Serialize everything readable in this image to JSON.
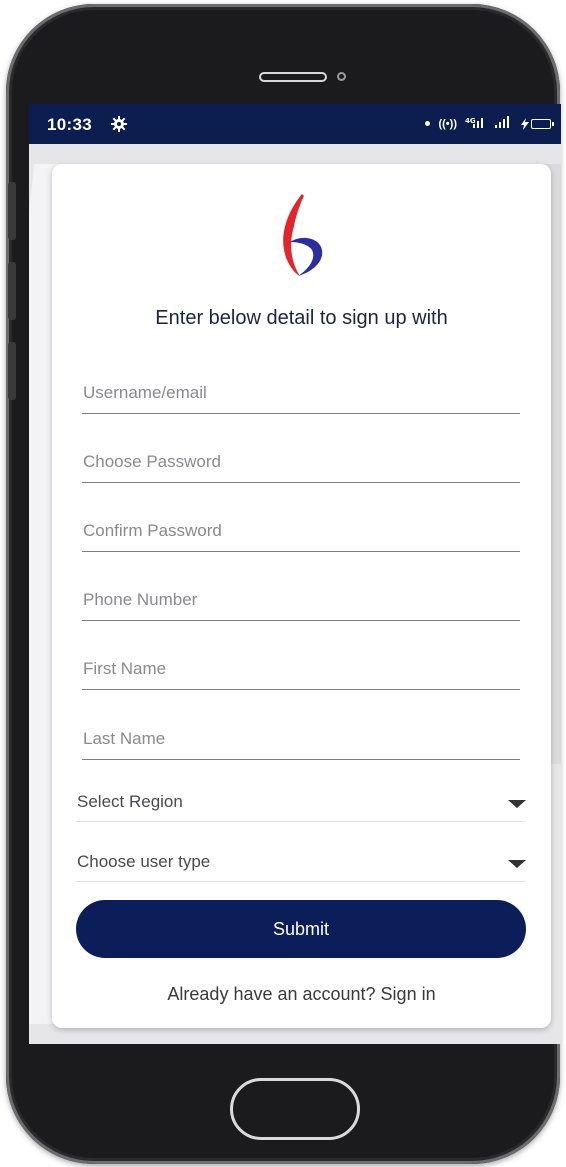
{
  "status_bar": {
    "time": "10:33",
    "icons": [
      "settings-icon",
      "dot-icon",
      "hotspot-icon",
      "signal-4g-icon",
      "signal-icon",
      "battery-charging-icon"
    ]
  },
  "form": {
    "title": "Enter below detail to sign up with",
    "username_placeholder": "Username/email",
    "password_placeholder": "Choose Password",
    "confirm_password_placeholder": "Confirm Password",
    "phone_placeholder": "Phone Number",
    "first_name_placeholder": "First Name",
    "last_name_placeholder": "Last Name",
    "region_select": "Select Region",
    "user_type_select": "Choose user type",
    "submit_label": "Submit",
    "signin_text": "Already have an account? Sign in"
  },
  "colors": {
    "status_bar": "#0b1e4f",
    "primary_button": "#0b1e5a",
    "logo_red": "#e0262b",
    "logo_blue": "#2b2f9e"
  }
}
